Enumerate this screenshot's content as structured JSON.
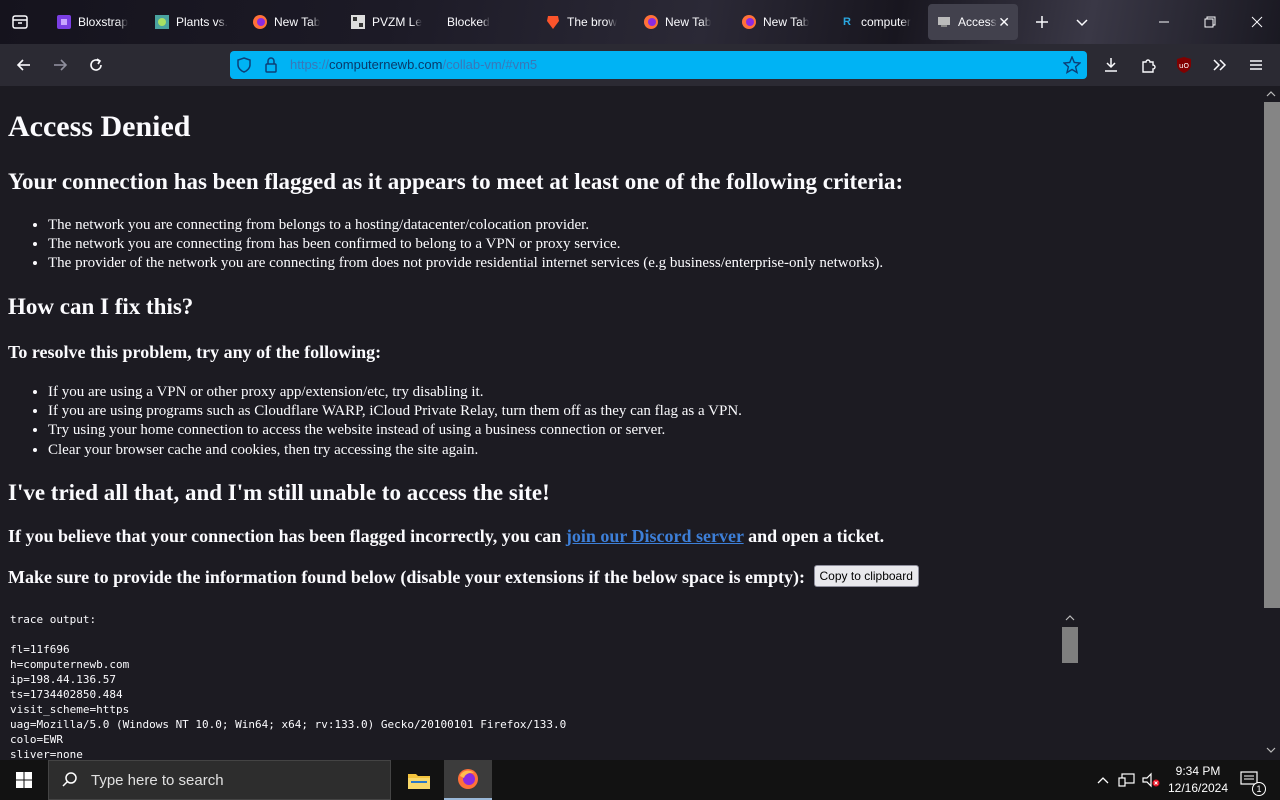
{
  "tabs": [
    {
      "label": "Bloxstrap",
      "icon": "bloxstrap-icon"
    },
    {
      "label": "Plants vs.",
      "icon": "plants-vs-zombies-icon"
    },
    {
      "label": "New Tab",
      "icon": "firefox-icon"
    },
    {
      "label": "PVZM Le",
      "icon": "pvzm-icon"
    },
    {
      "label": "Blocked",
      "icon": ""
    },
    {
      "label": "The brow",
      "icon": "brave-lion-icon"
    },
    {
      "label": "New Tab",
      "icon": "firefox-icon"
    },
    {
      "label": "New Tab",
      "icon": "firefox-icon"
    },
    {
      "label": "computer",
      "icon": "r-site-icon"
    },
    {
      "label": "Access",
      "icon": "computernewb-icon",
      "active": true
    }
  ],
  "url": {
    "scheme": "https://",
    "host": "computernewb.com",
    "path": "/collab-vm/#vm5"
  },
  "page": {
    "title": "Access Denied",
    "flagged_heading": "Your connection has been flagged as it appears to meet at least one of the following criteria:",
    "criteria": [
      "The network you are connecting from belongs to a hosting/datacenter/colocation provider.",
      "The network you are connecting from has been confirmed to belong to a VPN or proxy service.",
      "The provider of the network you are connecting from does not provide residential internet services (e.g business/enterprise-only networks)."
    ],
    "fix_heading": "How can I fix this?",
    "resolve_heading": "To resolve this problem, try any of the following:",
    "fixes": [
      "If you are using a VPN or other proxy app/extension/etc, try disabling it.",
      "If you are using programs such as Cloudflare WARP, iCloud Private Relay, turn them off as they can flag as a VPN.",
      "Try using your home connection to access the website instead of using a business connection or server.",
      "Clear your browser cache and cookies, then try accessing the site again."
    ],
    "still_heading": "I've tried all that, and I'm still unable to access the site!",
    "incorrect_prefix": "If you believe that your connection has been flagged incorrectly, you can ",
    "discord_link": "join our Discord server",
    "incorrect_suffix": " and open a ticket.",
    "provide_info": "Make sure to provide the information found below (disable your extensions if the below space is empty): ",
    "copy_button": "Copy to clipboard",
    "trace": "trace output:\n\nfl=11f696\nh=computernewb.com\nip=198.44.136.57\nts=1734402850.484\nvisit_scheme=https\nuag=Mozilla/5.0 (Windows NT 10.0; Win64; x64; rv:133.0) Gecko/20100101 Firefox/133.0\ncolo=EWR\nsliver=none"
  },
  "taskbar": {
    "search_placeholder": "Type here to search",
    "time": "9:34 PM",
    "date": "12/16/2024",
    "notification_count": "1"
  },
  "colors": {
    "urlbar_accent": "#00b3f4",
    "link": "#3d7fd8",
    "page_bg": "#1c1b22"
  }
}
